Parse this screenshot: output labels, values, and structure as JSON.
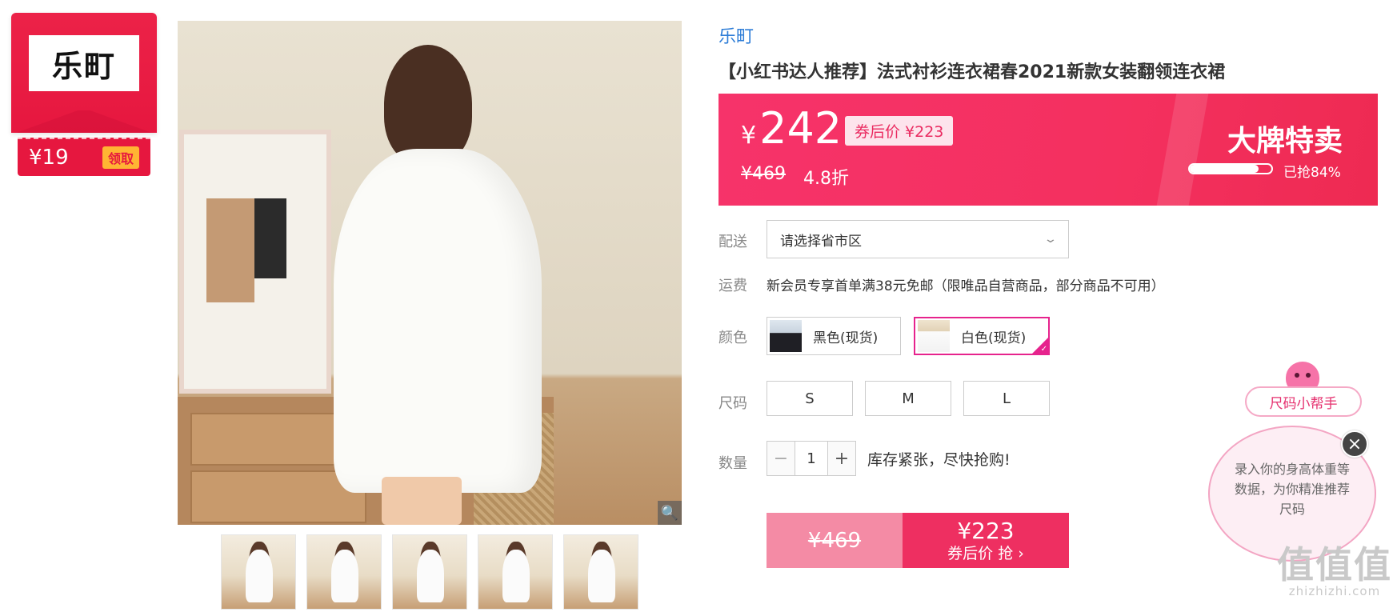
{
  "coupon": {
    "logo_text": "乐町",
    "amount": "¥19",
    "claim_label": "领取"
  },
  "product": {
    "brand": "乐町",
    "title": "【小红书达人推荐】法式衬衫连衣裙春2021新款女装翻领连衣裙"
  },
  "price": {
    "currency": "¥",
    "current": "242",
    "coupon_price_tag": "券后价 ¥223",
    "original": "¥469",
    "discount": "4.8折",
    "sale_title": "大牌特卖",
    "sold_label": "已抢84%",
    "sold_fraction": 0.84
  },
  "delivery": {
    "label": "配送",
    "select_value": "请选择省市区"
  },
  "shipping": {
    "label": "运费",
    "text": "新会员专享首单满38元免邮（限唯品自营商品，部分商品不可用）"
  },
  "color": {
    "label": "颜色",
    "options": [
      {
        "label": "黑色(现货)",
        "selected": false
      },
      {
        "label": "白色(现货)",
        "selected": true
      }
    ]
  },
  "size": {
    "label": "尺码",
    "options": [
      "S",
      "M",
      "L"
    ]
  },
  "quantity": {
    "label": "数量",
    "minus": "−",
    "value": "1",
    "plus": "+",
    "stock_text": "库存紧张，尽快抢购!"
  },
  "buy": {
    "original_price": "¥469",
    "coupon_price": "¥223",
    "action_label": "券后价 抢 ›"
  },
  "size_helper": {
    "title": "尺码小帮手",
    "message": "录入你的身高体重等数据，为你精准推荐尺码",
    "close_icon": "×"
  },
  "watermark": {
    "big": "值值值",
    "small": "zhizhizhi.com"
  },
  "icons": {
    "zoom": "🔍",
    "chevron": "⌄"
  },
  "colors": {
    "accent": "#f4305f",
    "brand_link": "#2e7dd7",
    "selected_border": "#e6238d"
  }
}
